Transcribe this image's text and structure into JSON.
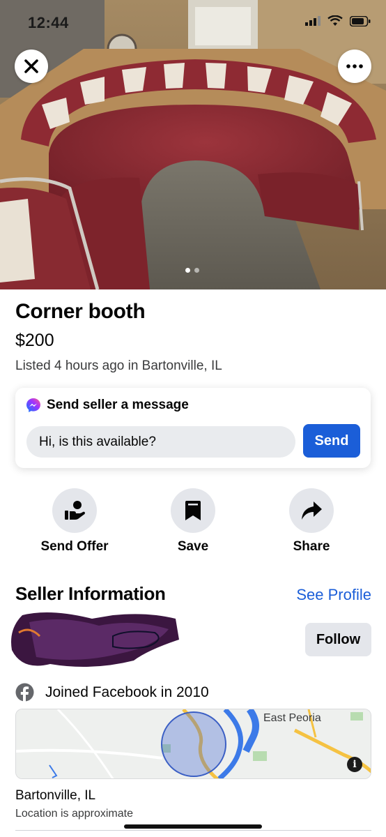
{
  "status_bar": {
    "time": "12:44"
  },
  "listing": {
    "title": "Corner booth",
    "price": "$200",
    "listed_text": "Listed 4 hours ago in Bartonville, IL",
    "photo_count": 2,
    "photo_index": 1
  },
  "message": {
    "header": "Send seller a message",
    "input_value": "Hi, is this available?",
    "send_label": "Send"
  },
  "actions": [
    {
      "label": "Send Offer",
      "icon": "offer-hand-icon"
    },
    {
      "label": "Save",
      "icon": "bookmark-icon"
    },
    {
      "label": "Share",
      "icon": "share-arrow-icon"
    }
  ],
  "seller": {
    "heading": "Seller Information",
    "see_profile": "See Profile",
    "follow_label": "Follow",
    "joined": "Joined Facebook in 2010"
  },
  "map": {
    "place_label": "East Peoria",
    "info_glyph": "i"
  },
  "location": {
    "city": "Bartonville, IL",
    "note": "Location is approximate"
  },
  "colors": {
    "accent": "#1b5ed8",
    "booth_red": "#8e2a33",
    "button_gray": "#e4e6eb"
  }
}
